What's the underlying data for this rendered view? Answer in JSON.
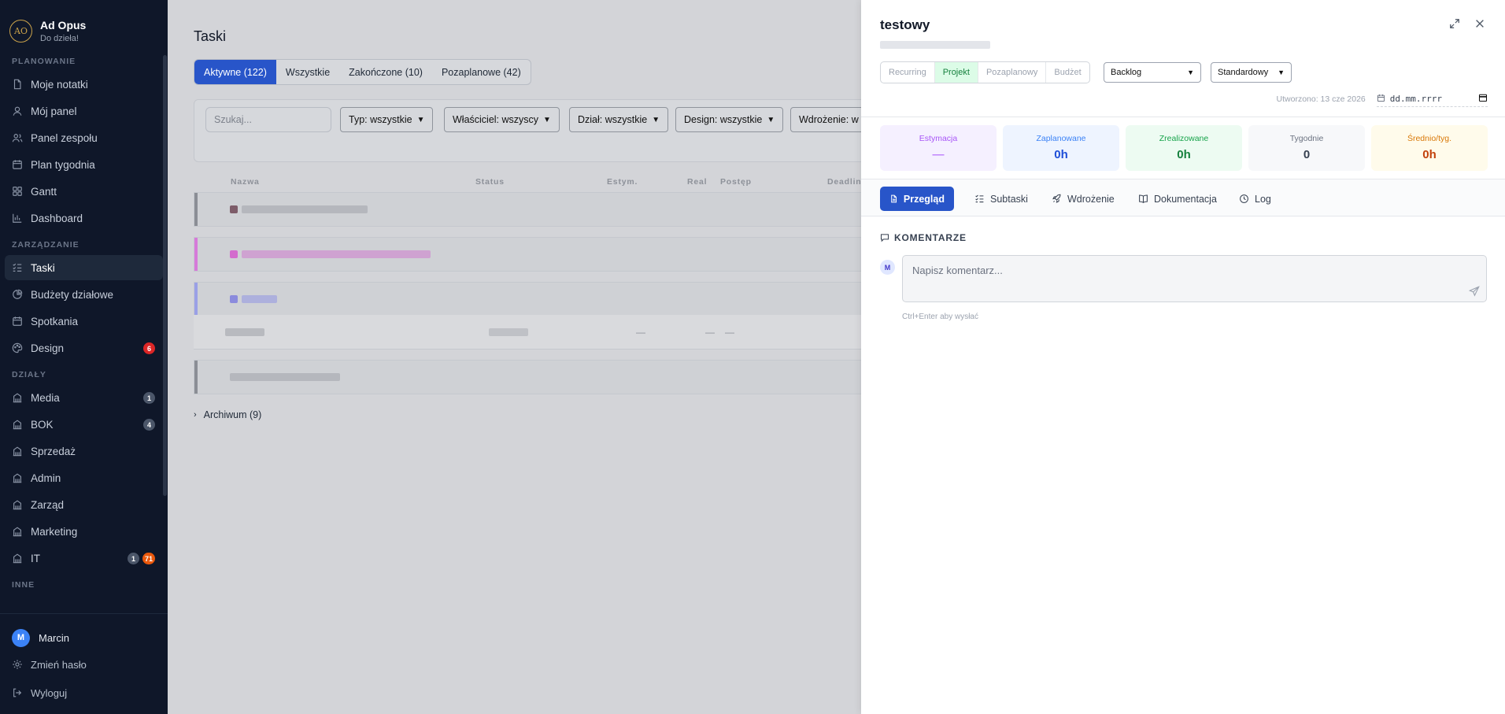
{
  "app": {
    "logo_text": "AO",
    "name": "Ad Opus",
    "tagline": "Do dzieła!"
  },
  "sidebar": {
    "sections": [
      {
        "title": "PLANOWANIE",
        "items": [
          {
            "label": "Moje notatki",
            "icon": "note-icon"
          },
          {
            "label": "Mój panel",
            "icon": "user-icon"
          },
          {
            "label": "Panel zespołu",
            "icon": "users-icon"
          },
          {
            "label": "Plan tygodnia",
            "icon": "calendar-icon"
          },
          {
            "label": "Gantt",
            "icon": "grid-icon"
          },
          {
            "label": "Dashboard",
            "icon": "bar-chart-icon"
          }
        ]
      },
      {
        "title": "ZARZĄDZANIE",
        "items": [
          {
            "label": "Taski",
            "icon": "list-check-icon",
            "active": true
          },
          {
            "label": "Budżety działowe",
            "icon": "pie-chart-icon"
          },
          {
            "label": "Spotkania",
            "icon": "calendar-icon"
          },
          {
            "label": "Design",
            "icon": "palette-icon",
            "badges": [
              {
                "value": "6",
                "color": "red"
              }
            ]
          }
        ]
      },
      {
        "title": "DZIAŁY",
        "items": [
          {
            "label": "Media",
            "icon": "building-icon",
            "badges": [
              {
                "value": "1",
                "color": "gray"
              }
            ]
          },
          {
            "label": "BOK",
            "icon": "building-icon",
            "badges": [
              {
                "value": "4",
                "color": "gray"
              }
            ]
          },
          {
            "label": "Sprzedaż",
            "icon": "building-icon"
          },
          {
            "label": "Admin",
            "icon": "building-icon"
          },
          {
            "label": "Zarząd",
            "icon": "building-icon"
          },
          {
            "label": "Marketing",
            "icon": "building-icon"
          },
          {
            "label": "IT",
            "icon": "building-icon",
            "badges": [
              {
                "value": "1",
                "color": "gray"
              },
              {
                "value": "71",
                "color": "orange"
              }
            ]
          }
        ]
      },
      {
        "title": "INNE",
        "items": []
      }
    ],
    "footer": {
      "user_initial": "M",
      "user_name": "Marcin",
      "change_password": "Zmień hasło",
      "logout": "Wyloguj"
    }
  },
  "main": {
    "title": "Taski",
    "tabs": [
      "Aktywne (122)",
      "Wszystkie",
      "Zakończone (10)",
      "Pozaplanowe (42)"
    ],
    "search_placeholder": "Szukaj...",
    "filters": [
      "Typ: wszystkie",
      "Właściciel: wszyscy",
      "Dział: wszystkie",
      "Design: wszystkie",
      "Wdrożenie: w"
    ],
    "columns": [
      "Nazwa",
      "Status",
      "Estym.",
      "Real",
      "Postęp",
      "Deadlin"
    ],
    "row_placeholders": {
      "estym": "—",
      "real": "—",
      "postep": "—"
    },
    "archive_label": "Archiwum (9)"
  },
  "drawer": {
    "title": "testowy",
    "type_options": [
      "Recurring",
      "Projekt",
      "Pozaplanowy",
      "Budżet"
    ],
    "type_selected": "Projekt",
    "status_select": "Backlog",
    "priority_select": "Standardowy",
    "created_label": "Utworzono: 13 cze 2026",
    "date_placeholder": "dd.mm.rrrr",
    "stats": [
      {
        "label": "Estymacja",
        "value": "—",
        "bg": "#f5f0ff",
        "label_color": "#a855f7",
        "value_color": "#c084fc"
      },
      {
        "label": "Zaplanowane",
        "value": "0h",
        "bg": "#eef4ff",
        "label_color": "#3b82f6",
        "value_color": "#1d4ed8"
      },
      {
        "label": "Zrealizowane",
        "value": "0h",
        "bg": "#edfbf2",
        "label_color": "#16a34a",
        "value_color": "#15803d"
      },
      {
        "label": "Tygodnie",
        "value": "0",
        "bg": "#f7f8fa",
        "label_color": "#6b7280",
        "value_color": "#374151"
      },
      {
        "label": "Średnio/tyg.",
        "value": "0h",
        "bg": "#fffbeb",
        "label_color": "#d97706",
        "value_color": "#c2410c"
      }
    ],
    "tabs": [
      {
        "label": "Przegląd",
        "icon": "document-icon",
        "active": true
      },
      {
        "label": "Subtaski",
        "icon": "list-check-icon"
      },
      {
        "label": "Wdrożenie",
        "icon": "rocket-icon"
      },
      {
        "label": "Dokumentacja",
        "icon": "book-icon"
      },
      {
        "label": "Log",
        "icon": "clock-icon"
      }
    ],
    "comments": {
      "title": "KOMENTARZE",
      "avatar_initial": "M",
      "placeholder": "Napisz komentarz...",
      "hint": "Ctrl+Enter aby wysłać"
    }
  }
}
